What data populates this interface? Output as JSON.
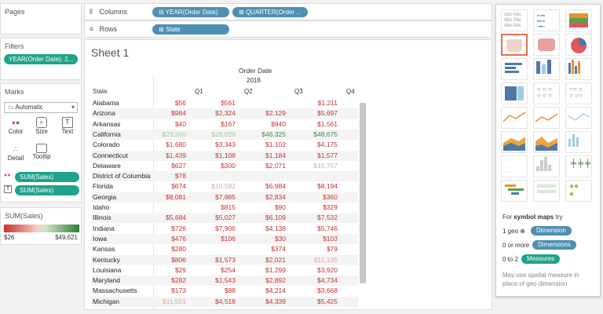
{
  "pages": {
    "title": "Pages"
  },
  "filters": {
    "title": "Filters",
    "pill": "YEAR(Order Date): 2..."
  },
  "marks": {
    "title": "Marks",
    "type": "Automatic",
    "buttons": [
      {
        "label": "Color",
        "icon": "color-dots-icon"
      },
      {
        "label": "Size",
        "icon": "size-icon"
      },
      {
        "label": "Text",
        "icon": "text-icon"
      },
      {
        "label": "Detail",
        "icon": "detail-icon"
      },
      {
        "label": "Tooltip",
        "icon": "tooltip-icon"
      }
    ],
    "fields": [
      "SUM(Sales)",
      "SUM(Sales)"
    ]
  },
  "legend": {
    "title": "SUM(Sales)",
    "min": "$26",
    "max": "$49,621",
    "low_color": "#c9302c",
    "high_color": "#2e7d32"
  },
  "shelves": {
    "columns_label": "Columns",
    "columns_pills": [
      "YEAR(Order Date)",
      "QUARTER(Order ..."
    ],
    "rows_label": "Rows",
    "rows_pills": [
      "State"
    ]
  },
  "sheet": {
    "title": "Sheet 1",
    "top_header": "Order Date",
    "year": "2018",
    "state_header": "State",
    "quarters": [
      "Q1",
      "Q2",
      "Q3",
      "Q4"
    ],
    "rows": [
      {
        "state": "Alabama",
        "q": [
          "$56",
          "$561",
          "",
          "$1,211"
        ]
      },
      {
        "state": "Arizona",
        "q": [
          "$984",
          "$2,324",
          "$2,129",
          "$5,697"
        ]
      },
      {
        "state": "Arkansas",
        "q": [
          "$40",
          "$167",
          "$940",
          "$1,561"
        ]
      },
      {
        "state": "California",
        "q": [
          "$23,360",
          "$28,029",
          "$46,325",
          "$48,675"
        ]
      },
      {
        "state": "Colorado",
        "q": [
          "$1,680",
          "$3,343",
          "$1,102",
          "$4,175"
        ]
      },
      {
        "state": "Connecticut",
        "q": [
          "$1,439",
          "$1,108",
          "$1,184",
          "$1,577"
        ]
      },
      {
        "state": "Delaware",
        "q": [
          "$627",
          "$300",
          "$2,071",
          "$10,757"
        ]
      },
      {
        "state": "District of Columbia",
        "q": [
          "$78",
          "",
          "",
          ""
        ]
      },
      {
        "state": "Florida",
        "q": [
          "$674",
          "$10,592",
          "$6,984",
          "$8,194"
        ]
      },
      {
        "state": "Georgia",
        "q": [
          "$8,081",
          "$7,885",
          "$2,834",
          "$360"
        ]
      },
      {
        "state": "Idaho",
        "q": [
          "",
          "$815",
          "$90",
          "$329"
        ]
      },
      {
        "state": "Illinois",
        "q": [
          "$5,684",
          "$5,027",
          "$6,109",
          "$7,532"
        ]
      },
      {
        "state": "Indiana",
        "q": [
          "$726",
          "$7,906",
          "$4,138",
          "$5,746"
        ]
      },
      {
        "state": "Iowa",
        "q": [
          "$476",
          "$106",
          "$30",
          "$103"
        ]
      },
      {
        "state": "Kansas",
        "q": [
          "$280",
          "",
          "$374",
          "$79"
        ]
      },
      {
        "state": "Kentucky",
        "q": [
          "$806",
          "$1,573",
          "$2,021",
          "$11,135"
        ]
      },
      {
        "state": "Louisiana",
        "q": [
          "$29",
          "$254",
          "$1,299",
          "$3,920"
        ]
      },
      {
        "state": "Maryland",
        "q": [
          "$282",
          "$1,543",
          "$2,892",
          "$4,734"
        ]
      },
      {
        "state": "Massachusetts",
        "q": [
          "$173",
          "$88",
          "$4,214",
          "$3,668"
        ]
      },
      {
        "state": "Michigan",
        "q": [
          "$11,551",
          "$4,518",
          "$4,339",
          "$5,425"
        ]
      }
    ]
  },
  "showme": {
    "hint_prefix": "For ",
    "hint_bold": "symbol maps",
    "hint_suffix": " try",
    "req1_text": "1 geo",
    "req1_pill": "Dimension",
    "req2_text": "0 or more",
    "req2_pill": "Dimensions",
    "req3_text": "0 to 2",
    "req3_pill": "Measures",
    "note_line1": "May use spatial measure in",
    "note_line2": "place of geo dimension"
  }
}
